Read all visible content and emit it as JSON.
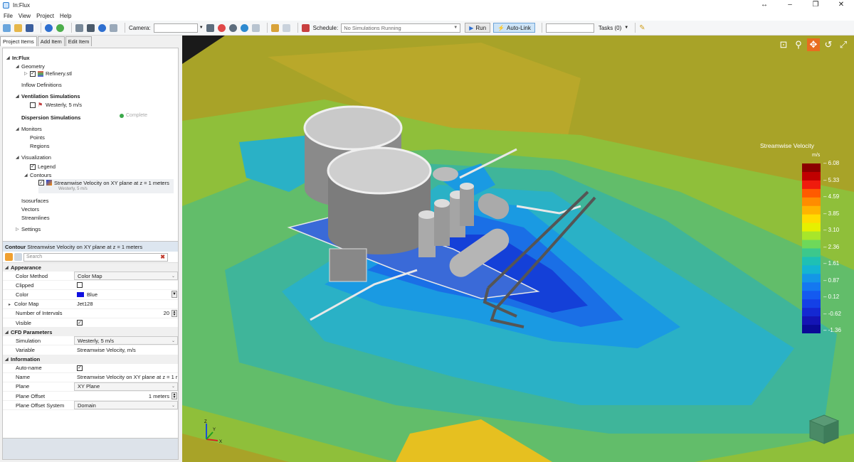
{
  "window": {
    "title": "In:Flux",
    "controls": [
      "↔",
      "–",
      "❐",
      "✕"
    ]
  },
  "menu": [
    "File",
    "View",
    "Project",
    "Help"
  ],
  "toolbar": {
    "camera_label": "Camera:",
    "schedule_label": "Schedule:",
    "schedule_value": "No Simulations Running",
    "run_label": "Run",
    "autolink_label": "Auto-Link",
    "tasks_label": "Tasks (0)"
  },
  "left_tabs": [
    "Project Items",
    "Add Item",
    "Edit Item"
  ],
  "tree": {
    "root": "In:Flux",
    "geometry": "Geometry",
    "refinery": "Refinery.stl",
    "inflow": "Inflow Definitions",
    "ventilation": "Ventilation Simulations",
    "westerly": "Westerly, 5 m/s",
    "complete": "Complete",
    "dispersion": "Dispersion Simulations",
    "monitors": "Monitors",
    "points": "Points",
    "regions": "Regions",
    "visualization": "Visualization",
    "legend": "Legend",
    "contours": "Contours",
    "contour_item": "Streamwise Velocity on XY plane at z = 1 meters",
    "contour_sub": "Westerly, 5 m/s",
    "isosurfaces": "Isosurfaces",
    "vectors": "Vectors",
    "streamlines": "Streamlines",
    "settings": "Settings"
  },
  "props": {
    "header_type": "Contour",
    "header_name": "Streamwise Velocity on XY plane at z = 1 meters",
    "search_placeholder": "Search",
    "appearance": "Appearance",
    "color_method_k": "Color Method",
    "color_method_v": "Color Map",
    "clipped_k": "Clipped",
    "color_k": "Color",
    "color_v": "Blue",
    "color_map_k": "Color Map",
    "color_map_v": "Jet128",
    "intervals_k": "Number of Intervals",
    "intervals_v": "20",
    "visible_k": "Visible",
    "cfd": "CFD Parameters",
    "simulation_k": "Simulation",
    "simulation_v": "Westerly, 5 m/s",
    "variable_k": "Variable",
    "variable_v": "Streamwise Velocity, m/s",
    "information": "Information",
    "autoname_k": "Auto-name",
    "name_k": "Name",
    "name_v": "Streamwise Velocity on XY plane at z = 1 r",
    "plane_k": "Plane",
    "plane_v": "XY Plane",
    "offset_k": "Plane Offset",
    "offset_v": "1 meters",
    "offset_system_k": "Plane Offset System",
    "offset_system_v": "Domain"
  },
  "legend": {
    "title": "Streamwise Velocity",
    "unit": "m/s",
    "ticks": [
      "6.08",
      "5.33",
      "4.59",
      "3.85",
      "3.10",
      "2.36",
      "1.61",
      "0.87",
      "0.12",
      "-0.62",
      "-1.36"
    ],
    "colors": [
      "#8b0000",
      "#c00000",
      "#ef1b0d",
      "#ff5a00",
      "#ff8c00",
      "#ffb400",
      "#ffdc00",
      "#e6f000",
      "#a8e62a",
      "#6ed85a",
      "#3cc88c",
      "#1ec0b4",
      "#14b4d2",
      "#1496e6",
      "#1478f0",
      "#145af0",
      "#1440e6",
      "#1428d2",
      "#1414b4",
      "#0a0a96"
    ]
  },
  "axes": {
    "x": "X",
    "y": "Y",
    "z": "Z"
  }
}
